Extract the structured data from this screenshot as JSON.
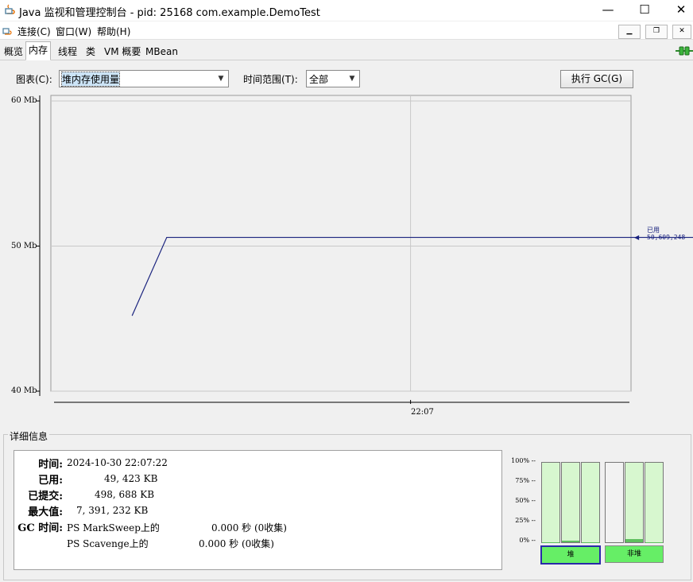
{
  "window": {
    "title": "Java 监视和管理控制台 - pid: 25168 com.example.DemoTest",
    "minimize_glyph": "—",
    "maximize_glyph": "☐",
    "close_glyph": "✕"
  },
  "menubar": {
    "items": [
      "连接(C)",
      "窗口(W)",
      "帮助(H)"
    ],
    "mdi_buttons": [
      "▁",
      "❐",
      "✕"
    ]
  },
  "tabs": [
    {
      "label": "概览",
      "active": false
    },
    {
      "label": "内存",
      "active": true
    },
    {
      "label": "线程",
      "active": false
    },
    {
      "label": "类",
      "active": false
    },
    {
      "label": "VM 概要",
      "active": false
    },
    {
      "label": "MBean",
      "active": false
    }
  ],
  "controls": {
    "chart_label": "图表(C):",
    "chart_value": "堆内存使用量",
    "range_label": "时间范围(T):",
    "range_value": "全部",
    "gc_button": "执行 GC(G)"
  },
  "chart_data": {
    "type": "line",
    "y_unit": "Mb",
    "ylim": [
      40,
      60
    ],
    "y_ticks": [
      "60 Mb",
      "50 Mb",
      "40 Mb"
    ],
    "x_ticks": [
      "22:07"
    ],
    "series": [
      {
        "name": "已用",
        "value_label": "50,609,248",
        "color": "#1a237e",
        "points": [
          [
            0.0,
            45.2
          ],
          [
            0.06,
            50.6
          ],
          [
            1.0,
            50.6
          ]
        ]
      }
    ],
    "grid": true,
    "legend": "right"
  },
  "details": {
    "title": "详细信息",
    "rows": [
      {
        "key": "时间:",
        "value": "2024-10-30 22:07:22"
      },
      {
        "key": "已用:",
        "value": "49, 423 KB"
      },
      {
        "key": "已提交:",
        "value": "498, 688 KB"
      },
      {
        "key": "最大值:",
        "value": "7, 391, 232 KB"
      },
      {
        "key": "GC 时间:",
        "value": "PS MarkSweep上的",
        "extra": "0.000 秒 (0收集)"
      }
    ],
    "gc_second": {
      "name": "PS Scavenge上的",
      "extra": "0.000 秒 (0收集)"
    }
  },
  "memory_bars": {
    "pct_labels": [
      "100% --",
      "75% --",
      "50% --",
      "25% --",
      "0% --"
    ],
    "heap_label": "堆",
    "nonheap_label": "非堆",
    "heap_fill": [
      0.005,
      0.02,
      0.005
    ],
    "nonheap_fill": [
      0.0,
      0.04,
      0.005
    ],
    "bar_color": "#d7f7cf",
    "accent": "#66ee66"
  }
}
